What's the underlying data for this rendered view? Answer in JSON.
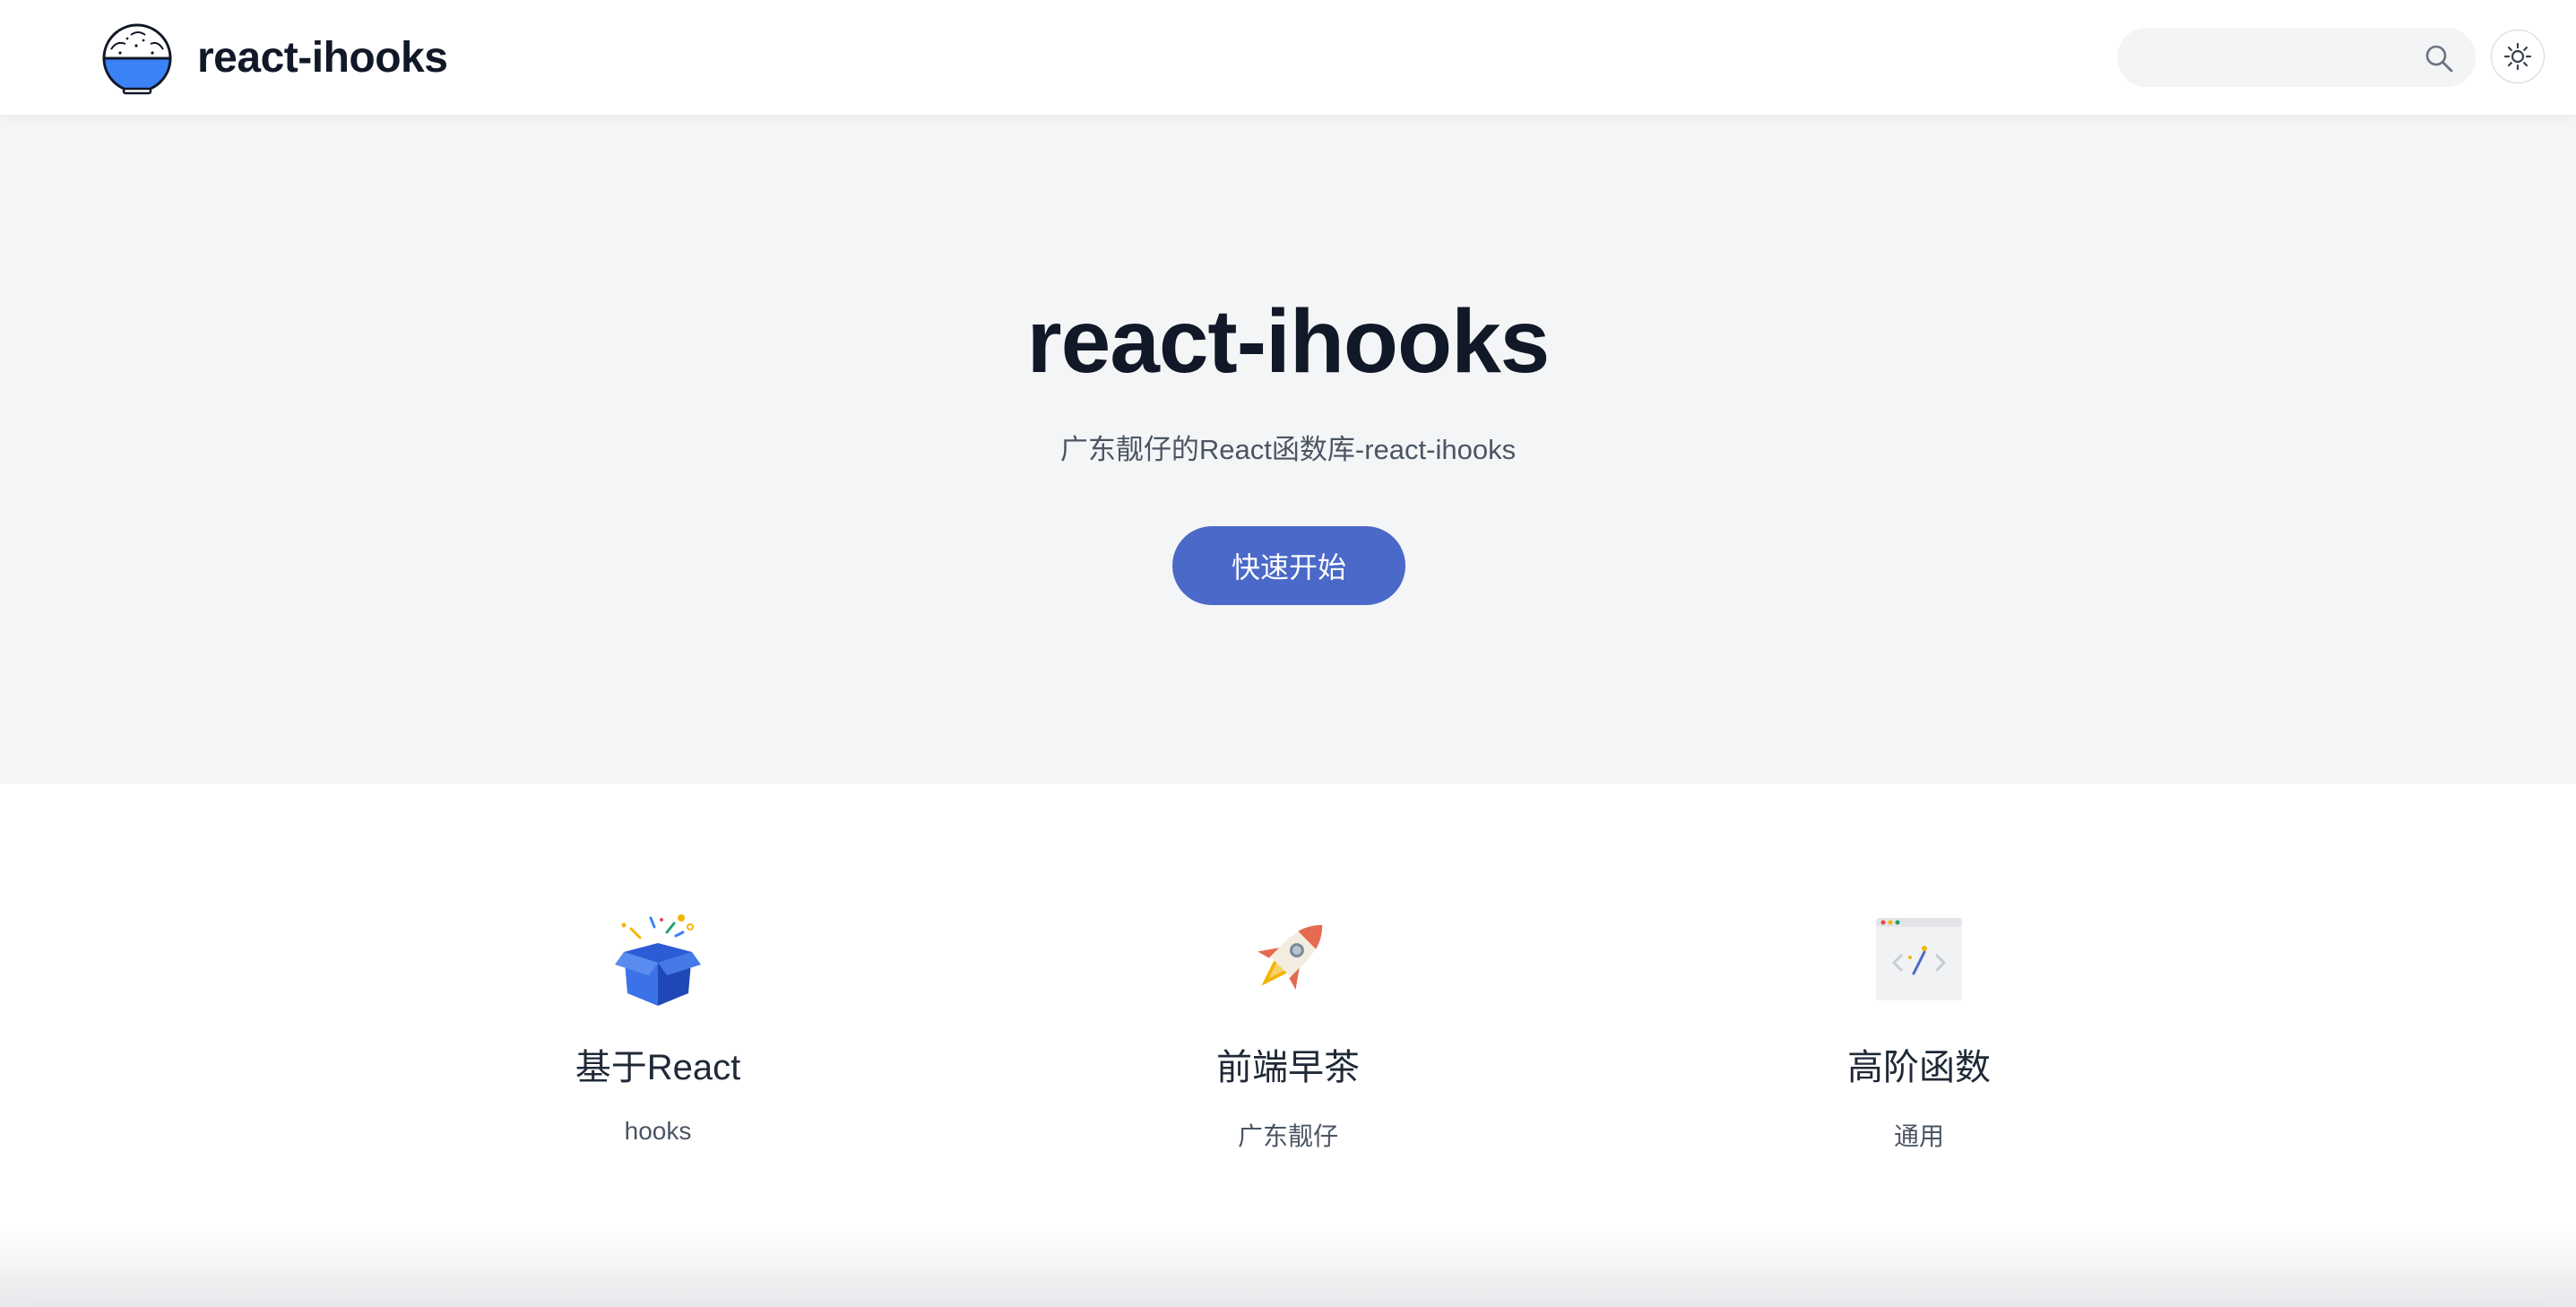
{
  "header": {
    "brand_title": "react-ihooks",
    "logo_icon": "rice-bowl-icon",
    "search": {
      "placeholder": "",
      "value": ""
    },
    "search_icon": "search-icon",
    "theme_toggle_icon": "sun-icon"
  },
  "hero": {
    "title": "react-ihooks",
    "subtitle": "广东靓仔的React函数库-react-ihooks",
    "cta_label": "快速开始",
    "accent_color": "#4a69c8"
  },
  "features": [
    {
      "icon": "gift-box-icon",
      "title": "基于React",
      "desc": "hooks"
    },
    {
      "icon": "rocket-icon",
      "title": "前端早茶",
      "desc": "广东靓仔"
    },
    {
      "icon": "code-window-icon",
      "title": "高阶函数",
      "desc": "通用"
    }
  ]
}
